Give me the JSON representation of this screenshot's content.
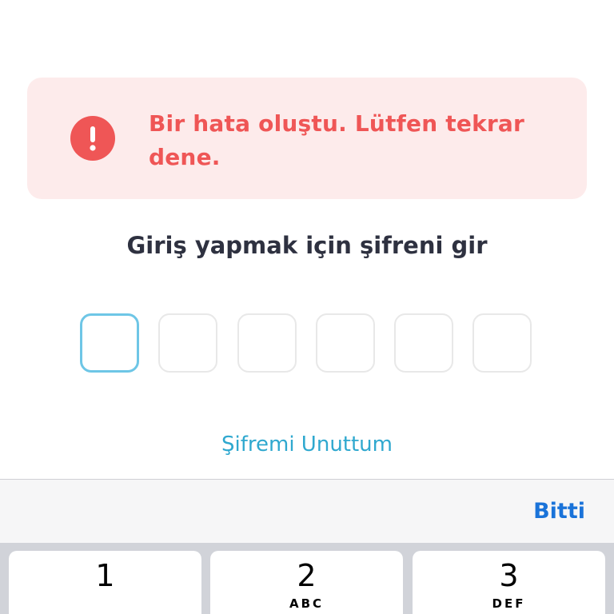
{
  "colors": {
    "alert_background": "#fdebeb",
    "alert_accent": "#ef5656",
    "title_text": "#2e3140",
    "active_pin_border": "#6ec6e6",
    "inactive_pin_border": "#e8e8e8",
    "link": "#2fa8cf",
    "done_button": "#1a73d9",
    "keypad_background": "#d1d3d9"
  },
  "alert": {
    "icon": "exclamation-circle-icon",
    "message": "Bir hata oluştu. Lütfen tekrar dene."
  },
  "login": {
    "title": "Giriş yapmak için şifreni gir",
    "pin_length": 6,
    "active_index": 0,
    "forgot_link": "Şifremi Unuttum"
  },
  "keyboard": {
    "done_label": "Bitti",
    "keys": [
      {
        "digit": "1",
        "letters": ""
      },
      {
        "digit": "2",
        "letters": "ABC"
      },
      {
        "digit": "3",
        "letters": "DEF"
      }
    ]
  }
}
